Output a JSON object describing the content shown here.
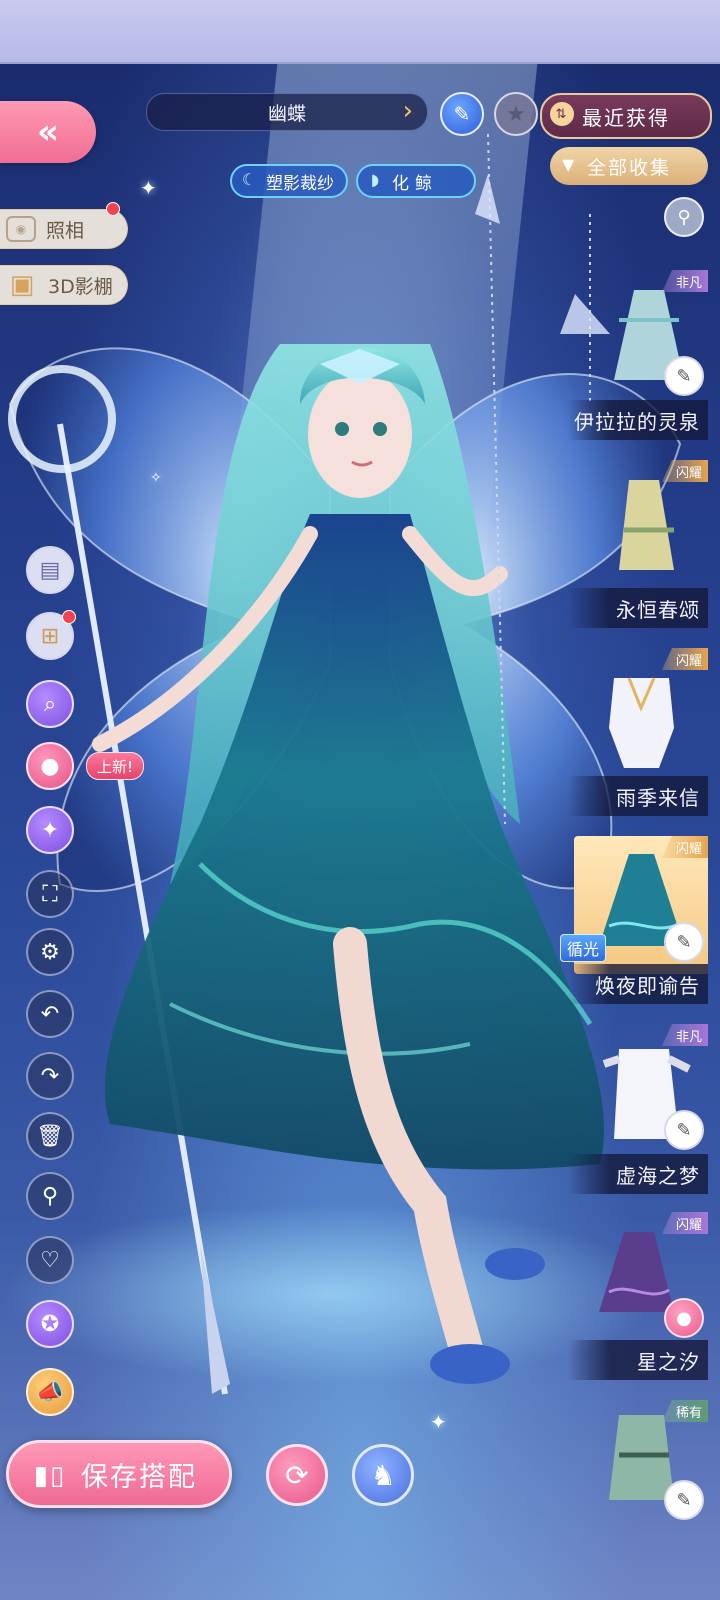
{
  "header": {
    "back_label": "«",
    "outfit_name": "幽蝶",
    "name_arrow": "›",
    "recent_label": "最近获得",
    "all_label": "全部收集",
    "chip_left": "塑影裁纱",
    "chip_right": "化鲸"
  },
  "left_panel": {
    "photo_label": "照相",
    "studio_label": "3D影棚",
    "new_badge": "上新!"
  },
  "gallery": {
    "glow_tag": "循光",
    "items": [
      {
        "name": "伊拉拉的灵泉",
        "tier": "非凡"
      },
      {
        "name": "永恒春颂",
        "tier": "闪耀"
      },
      {
        "name": "雨季来信",
        "tier": "闪耀"
      },
      {
        "name": "焕夜即谕告",
        "tier": "闪耀"
      },
      {
        "name": "虚海之梦",
        "tier": "非凡"
      },
      {
        "name": "星之汐",
        "tier": "闪耀"
      },
      {
        "name": "",
        "tier": "稀有"
      }
    ]
  },
  "bottom": {
    "save_label": "保存搭配"
  },
  "colors": {
    "accent_pink": "#ef6a93",
    "gold": "#e6a54d",
    "deep_blue": "#243d8a"
  }
}
